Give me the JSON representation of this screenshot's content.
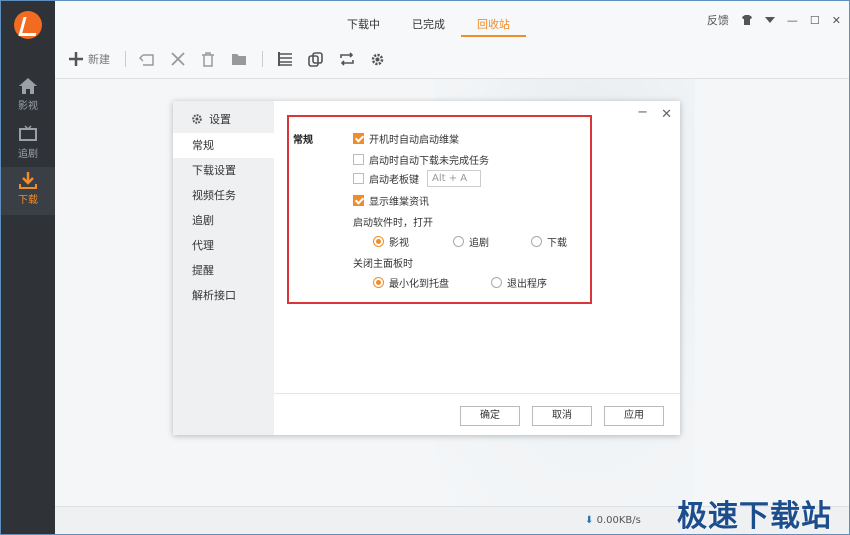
{
  "app": {
    "accent": "#f28c28"
  },
  "sidebar": {
    "items": [
      {
        "label": "影视",
        "icon": "home-icon"
      },
      {
        "label": "追剧",
        "icon": "tv-icon"
      },
      {
        "label": "下载",
        "icon": "download-icon",
        "active": true
      }
    ]
  },
  "tabs": [
    {
      "label": "下载中"
    },
    {
      "label": "已完成"
    },
    {
      "label": "回收站",
      "active": true
    }
  ],
  "window": {
    "feedback": "反馈",
    "minimize": "—",
    "maximize": "☐",
    "close": "✕"
  },
  "toolbar": {
    "new_label": "新建"
  },
  "status": {
    "speed": "0.00KB/s"
  },
  "watermark": "极速下载站",
  "dialog": {
    "title": "设置",
    "nav": [
      "常规",
      "下载设置",
      "视频任务",
      "追剧",
      "代理",
      "提醒",
      "解析接口"
    ],
    "section_label": "常规",
    "options": {
      "autostart": "开机时自动启动维棠",
      "auto_download": "启动时自动下载未完成任务",
      "boss_key": "启动老板键",
      "boss_key_value": "Alt + A",
      "show_news": "显示维棠资讯"
    },
    "startup_label": "启动软件时，打开",
    "startup_options": [
      "影视",
      "追剧",
      "下载"
    ],
    "close_label": "关闭主面板时",
    "close_options": [
      "最小化到托盘",
      "退出程序"
    ],
    "ok": "确定",
    "cancel": "取消",
    "apply": "应用"
  }
}
